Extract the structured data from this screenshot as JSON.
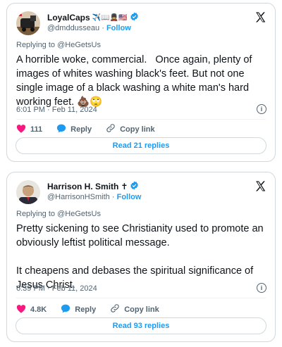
{
  "tweets": [
    {
      "display_name": "LoyalCaps",
      "name_emojis": "✈️📖💂🇺🇸",
      "handle": "@dmddusseau",
      "follow_label": "Follow",
      "replying_prefix": "Replying to ",
      "replying_to": "@HeGetsUs",
      "body": "A horrible woke, commercial.   Once again, plenty of images of whites washing black's feet. But not one single image of a black washing a white man's hard working feet. 💩🙄",
      "time": "6:01 PM · Feb 11, 2024",
      "likes": "111",
      "reply_label": "Reply",
      "copy_label": "Copy link",
      "read_replies": "Read 21 replies"
    },
    {
      "display_name": "Harrison H. Smith",
      "name_emojis": "✝",
      "handle": "@HarrisonHSmith",
      "follow_label": "Follow",
      "replying_prefix": "Replying to ",
      "replying_to": "@HeGetsUs",
      "body": "Pretty sickening to see Christianity used to promote an obviously leftist political message.\n\nIt cheapens and debases the spiritual significance of Jesus Christ.",
      "time": "6:39 PM · Feb 11, 2024",
      "likes": "4.8K",
      "reply_label": "Reply",
      "copy_label": "Copy link",
      "read_replies": "Read 93 replies"
    }
  ],
  "icons": {
    "verified": "verified-badge-icon",
    "x_logo": "x-logo-icon",
    "info": "info-icon",
    "like": "heart-icon",
    "reply": "reply-bubble-icon",
    "copy": "link-icon"
  },
  "colors": {
    "accent": "#1d9bf0",
    "like": "#f91880",
    "muted": "#536471",
    "border": "#cfd9de"
  }
}
